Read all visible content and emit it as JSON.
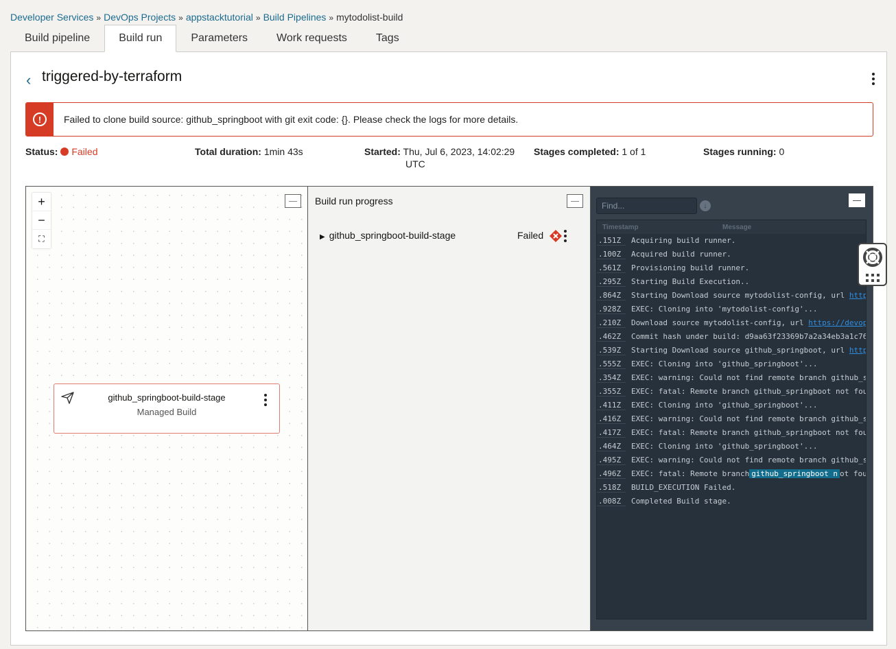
{
  "breadcrumb": [
    "Developer Services",
    "DevOps Projects",
    "appstacktutorial",
    "Build Pipelines",
    "mytodolist-build"
  ],
  "tabs": [
    "Build pipeline",
    "Build run",
    "Parameters",
    "Work requests",
    "Tags"
  ],
  "active_tab": "Build run",
  "title": "triggered-by-terraform",
  "alert": "Failed to clone build source: github_springboot with git exit code: {}. Please check the logs for more details.",
  "stats": {
    "status_label": "Status:",
    "status": "Failed",
    "duration_label": "Total duration:",
    "duration": "1min 43s",
    "started_label": "Started:",
    "started": "Thu, Jul 6, 2023, 14:02:29",
    "started_tz": "UTC",
    "completed_label": "Stages completed:",
    "completed": "1 of 1",
    "running_label": "Stages running:",
    "running": "0"
  },
  "graph": {
    "node_name": "github_springboot-build-stage",
    "node_type": "Managed Build"
  },
  "progress": {
    "title": "Build run progress",
    "stage": "github_springboot-build-stage",
    "stage_status": "Failed"
  },
  "logs": {
    "find_placeholder": "Find...",
    "col_timestamp": "Timestamp",
    "col_message": "Message",
    "rows": [
      {
        "ts": ".151Z",
        "msg": "Acquiring build runner."
      },
      {
        "ts": ".100Z",
        "msg": "Acquired build runner."
      },
      {
        "ts": ".561Z",
        "msg": "Provisioning build runner."
      },
      {
        "ts": ".295Z",
        "msg": "Starting Build Execution.."
      },
      {
        "ts": ".864Z",
        "msg": "Starting Download source mytodolist-config, url ",
        "link": "http"
      },
      {
        "ts": ".928Z",
        "msg": "EXEC: Cloning into 'mytodolist-config'..."
      },
      {
        "ts": ".210Z",
        "msg": "Download source mytodolist-config, url ",
        "link": "https://devop"
      },
      {
        "ts": ".462Z",
        "msg": "Commit hash under build: d9aa63f23369b7a2a34eb3a1c76"
      },
      {
        "ts": ".539Z",
        "msg": "Starting Download source github_springboot, url ",
        "link": "http"
      },
      {
        "ts": ".555Z",
        "msg": "EXEC: Cloning into 'github_springboot'..."
      },
      {
        "ts": ".354Z",
        "msg": "EXEC: warning: Could not find remote branch github_s"
      },
      {
        "ts": ".355Z",
        "msg": "EXEC: fatal: Remote branch github_springboot not fou"
      },
      {
        "ts": ".411Z",
        "msg": "EXEC: Cloning into 'github_springboot'..."
      },
      {
        "ts": ".416Z",
        "msg": "EXEC: warning: Could not find remote branch github_s"
      },
      {
        "ts": ".417Z",
        "msg": "EXEC: fatal: Remote branch github_springboot not fou"
      },
      {
        "ts": ".464Z",
        "msg": "EXEC: Cloning into 'github_springboot'..."
      },
      {
        "ts": ".495Z",
        "msg": "EXEC: warning: Could not find remote branch github_s"
      },
      {
        "ts": ".496Z",
        "msg": "EXEC: fatal: Remote branch",
        "highlight": "github_springboot n",
        "after": "ot fou"
      },
      {
        "ts": ".518Z",
        "msg": "BUILD_EXECUTION Failed."
      },
      {
        "ts": ".008Z",
        "msg": "Completed Build stage."
      }
    ]
  },
  "colors": {
    "error": "#d63b25",
    "link": "#1b6b8f",
    "log_bg": "#27313b"
  }
}
